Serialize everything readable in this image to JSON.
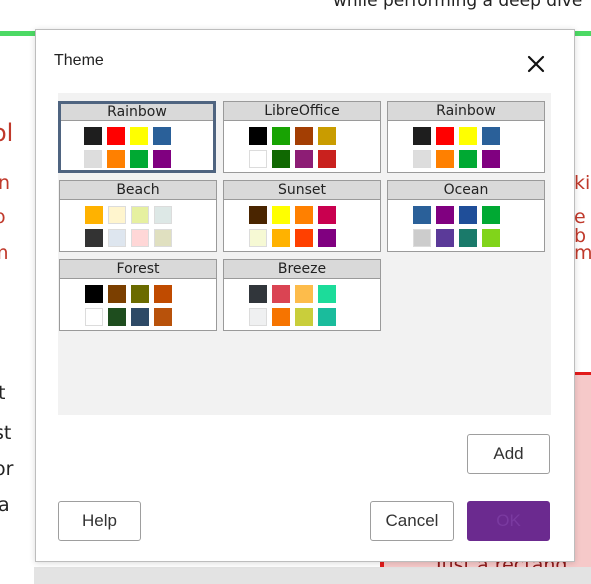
{
  "background": {
    "top_text": "while performing a deep dive",
    "bottom_text": "Just a rectang",
    "left_fragments": [
      "ol",
      "n",
      "o",
      "m",
      "t",
      "st",
      "or",
      "a"
    ],
    "right_fragments": [
      "ki",
      "e b",
      "m"
    ]
  },
  "dialog": {
    "title": "Theme",
    "close_icon": "close-icon",
    "themes": [
      {
        "name": "Rainbow",
        "selected": true,
        "colors": [
          "#1e1e1e",
          "#ff0000",
          "#ffff00",
          "#2a6099",
          "#dddddd",
          "#ff8000",
          "#00a933",
          "#800080"
        ]
      },
      {
        "name": "LibreOffice",
        "selected": false,
        "colors": [
          "#000000",
          "#18a303",
          "#a33e03",
          "#c99c00",
          "#ffffff",
          "#106802",
          "#8d1d75",
          "#c9211e"
        ]
      },
      {
        "name": "Rainbow",
        "selected": false,
        "colors": [
          "#1e1e1e",
          "#ff0000",
          "#ffff00",
          "#2a6099",
          "#dddddd",
          "#ff8000",
          "#00a933",
          "#800080"
        ]
      },
      {
        "name": "Beach",
        "selected": false,
        "colors": [
          "#ffb200",
          "#fff5ce",
          "#e6f0a0",
          "#dde8e6",
          "#333333",
          "#dee6ef",
          "#ffd7d7",
          "#e0e0c0"
        ]
      },
      {
        "name": "Sunset",
        "selected": false,
        "colors": [
          "#4a2500",
          "#ffff00",
          "#ff8000",
          "#c9004f",
          "#f6f9d4",
          "#ffb200",
          "#ff4000",
          "#800080"
        ]
      },
      {
        "name": "Ocean",
        "selected": false,
        "colors": [
          "#2a6099",
          "#800080",
          "#1f4e99",
          "#00a933",
          "#cccccc",
          "#5b3a99",
          "#1a7a6a",
          "#81d41a"
        ]
      },
      {
        "name": "Forest",
        "selected": false,
        "colors": [
          "#000000",
          "#7b3f00",
          "#6b6b00",
          "#c04b00",
          "#ffffff",
          "#1e4d1e",
          "#2e4a66",
          "#b8520b"
        ]
      },
      {
        "name": "Breeze",
        "selected": false,
        "colors": [
          "#31363b",
          "#da4453",
          "#fdbc4b",
          "#1cdc9a",
          "#eff0f1",
          "#f67400",
          "#c9ce3b",
          "#1abc9c"
        ]
      }
    ],
    "buttons": {
      "add": "Add",
      "help": "Help",
      "cancel": "Cancel",
      "ok": "OK"
    }
  }
}
